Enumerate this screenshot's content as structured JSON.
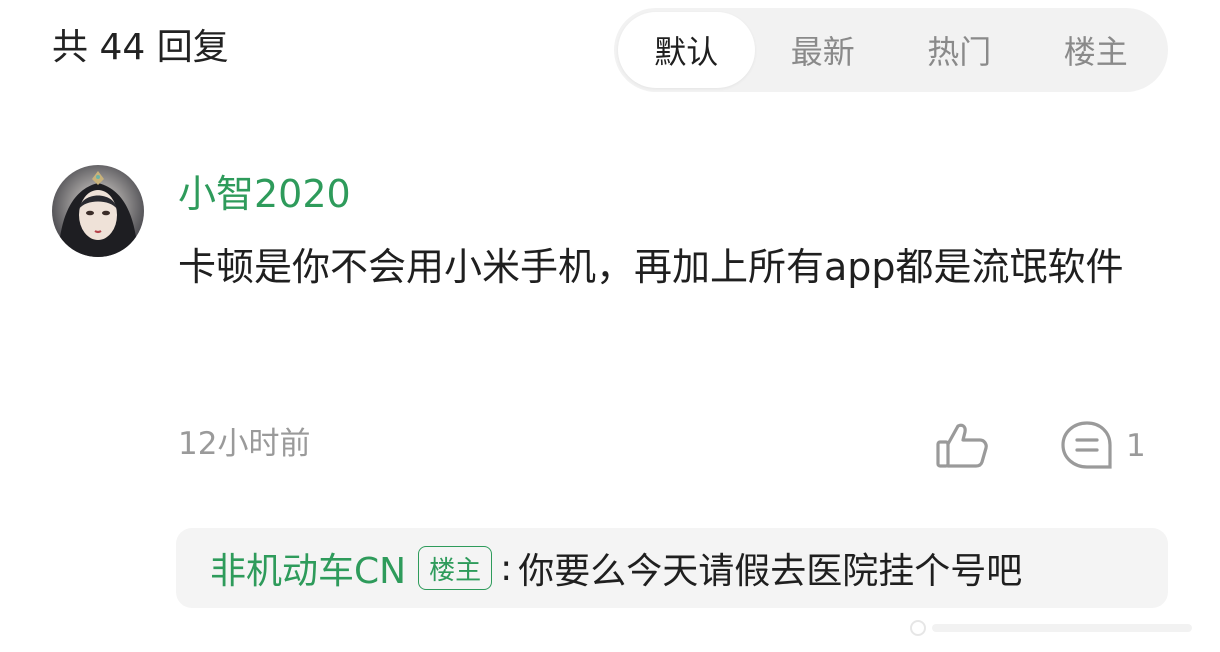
{
  "header": {
    "reply_count_label": "共 44 回复",
    "sort_tabs": [
      {
        "label": "默认",
        "active": true
      },
      {
        "label": "最新",
        "active": false
      },
      {
        "label": "热门",
        "active": false
      },
      {
        "label": "楼主",
        "active": false
      }
    ]
  },
  "comment": {
    "username": "小智2020",
    "text": "卡顿是你不会用小米手机，再加上所有app都是流氓软件",
    "timestamp": "12小时前",
    "like_icon": "thumbs-up-icon",
    "reply_icon": "comment-icon",
    "reply_count": "1",
    "sub_reply": {
      "author": "非机动车CN",
      "badge": "楼主",
      "separator": ":",
      "text": "你要么今天请假去医院挂个号吧"
    }
  },
  "colors": {
    "accent_green": "#2e9b5b",
    "muted_gray": "#9a9a9a",
    "tab_bg": "#f2f2f2",
    "sub_reply_bg": "#f4f4f4"
  }
}
